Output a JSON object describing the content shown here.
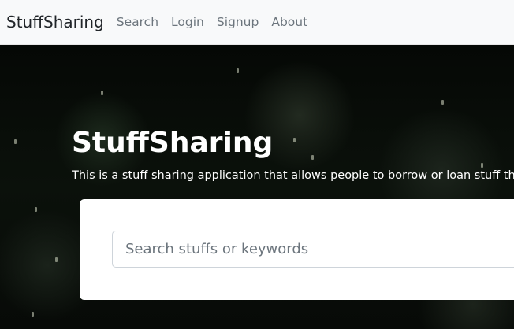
{
  "navbar": {
    "brand": "StuffSharing",
    "links": [
      "Search",
      "Login",
      "Signup",
      "About"
    ]
  },
  "hero": {
    "title": "StuffSharing",
    "description": "This is a stuff sharing application that allows people to borrow or loan stuff that"
  },
  "search": {
    "placeholder": "Search stuffs or keywords",
    "value": ""
  },
  "colors": {
    "navbar_bg": "#f8f9fa",
    "hero_bg": "#070a07",
    "text_on_dark": "#ffffff",
    "link_muted": "#6c757d"
  }
}
